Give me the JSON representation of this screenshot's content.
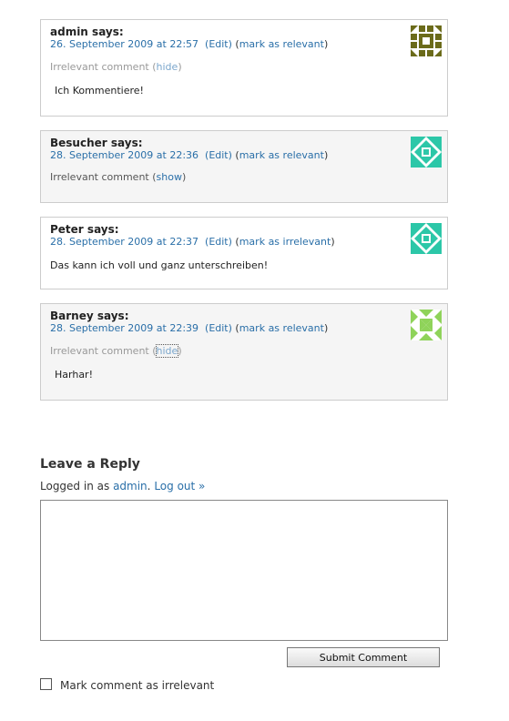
{
  "comments": [
    {
      "author": "admin",
      "says": "says:",
      "date": "26. September 2009 at 22:57",
      "edit": "(Edit)",
      "mark_open": "(",
      "mark_link": "mark as relevant",
      "mark_close": ")",
      "irrelevant_text": "Irrelevant comment (",
      "toggle": "hide",
      "irrelevant_close": ")",
      "text": "Ich Kommentiere!",
      "avatar_color": "#6b6b1a"
    },
    {
      "author": "Besucher",
      "says": "says:",
      "date": "28. September 2009 at 22:36",
      "edit": "(Edit)",
      "mark_open": "(",
      "mark_link": "mark as relevant",
      "mark_close": ")",
      "irrelevant_text": "Irrelevant comment (",
      "toggle": "show",
      "irrelevant_close": ")",
      "avatar_color": "#2cc7a8"
    },
    {
      "author": "Peter",
      "says": "says:",
      "date": "28. September 2009 at 22:37",
      "edit": "(Edit)",
      "mark_open": "(",
      "mark_link": "mark as irrelevant",
      "mark_close": ")",
      "text": "Das kann ich voll und ganz unterschreiben!",
      "avatar_color": "#2cc7a8"
    },
    {
      "author": "Barney",
      "says": "says:",
      "date": "28. September 2009 at 22:39",
      "edit": "(Edit)",
      "mark_open": "(",
      "mark_link": "mark as relevant",
      "mark_close": ")",
      "irrelevant_text": "Irrelevant comment (",
      "toggle": "hide",
      "irrelevant_close": ")",
      "text": "Harhar!",
      "avatar_color": "#8fd35a"
    }
  ],
  "reply": {
    "title": "Leave a Reply",
    "logged_in_prefix": "Logged in as",
    "user": "admin",
    "dot": ".",
    "logout": "Log out »",
    "textarea_value": "",
    "submit_label": "Submit Comment",
    "checkbox_label": "Mark comment as irrelevant"
  },
  "colors": {
    "link": "#2a6fa8",
    "muted": "#999999",
    "box_border": "#cccccc",
    "alt_bg": "#f5f5f5"
  }
}
